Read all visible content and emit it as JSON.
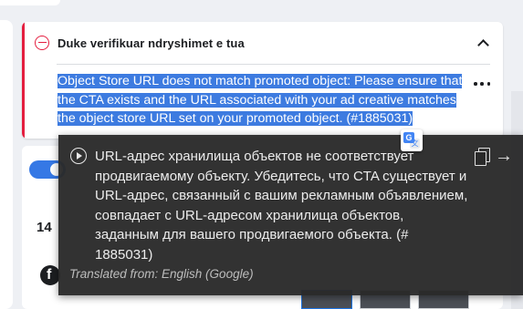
{
  "card": {
    "title": "Duke verifikuar ndryshimet e tua",
    "message": "Object Store URL does not match promoted object: Please ensure that the CTA exists and the URL associated with your ad creative matches the object store URL set on your promoted object. (#1885031)"
  },
  "background": {
    "count_label": "14"
  },
  "popup": {
    "translated_text": "URL-адрес хранилища объектов не соответствует продвигаемому объекту. Убедитесь, что CTA существует и URL-адрес, связанный с вашим рекламным объявлением, совпадает с URL-адресом хранилища объектов, заданным для вашего продвигаемого объекта. (# 1885031)",
    "footer": "Translated from: English (Google)",
    "open_glyph": "→"
  },
  "colors": {
    "accent_error": "#e41e3f",
    "selection": "#3d7be0",
    "popup_bg": "#2a2a2a",
    "toggle": "#3578e5"
  },
  "icons": [
    "error-circle-icon",
    "chevron-up-icon",
    "more-icon",
    "translate-icon",
    "play-icon",
    "copy-icon",
    "arrow-right-icon",
    "facebook-icon"
  ]
}
